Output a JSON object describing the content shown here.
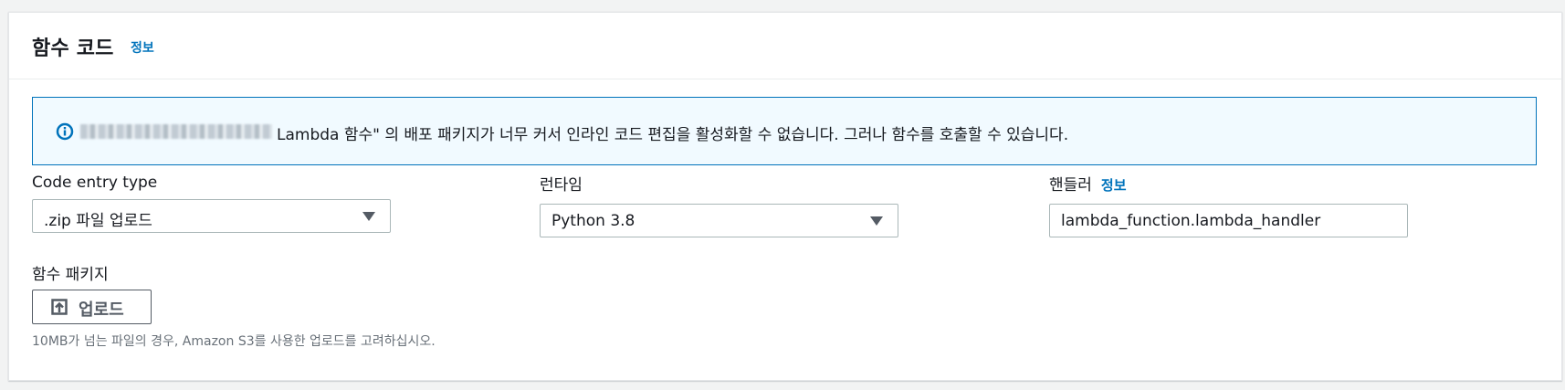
{
  "panel": {
    "title": "함수 코드",
    "info_link": "정보"
  },
  "alert": {
    "icon": "info-icon",
    "message": "Lambda 함수\" 의 배포 패키지가 너무 커서 인라인 코드 편집을 활성화할 수 없습니다. 그러나 함수를 호출할 수 있습니다."
  },
  "code_entry": {
    "label": "Code entry type",
    "value": ".zip 파일 업로드"
  },
  "runtime": {
    "label": "런타임",
    "value": "Python 3.8"
  },
  "handler": {
    "label": "핸들러",
    "info_link": "정보",
    "value": "lambda_function.lambda_handler"
  },
  "package": {
    "label": "함수 패키지",
    "upload_label": "업로드",
    "upload_icon": "upload-icon",
    "hint": "10MB가 넘는 파일의 경우, Amazon S3를 사용한 업로드를 고려하십시오."
  },
  "colors": {
    "accent": "#0073bb",
    "alert_bg": "#f1faff",
    "border": "#aab7b8",
    "text": "#16191f",
    "muted": "#687078"
  }
}
